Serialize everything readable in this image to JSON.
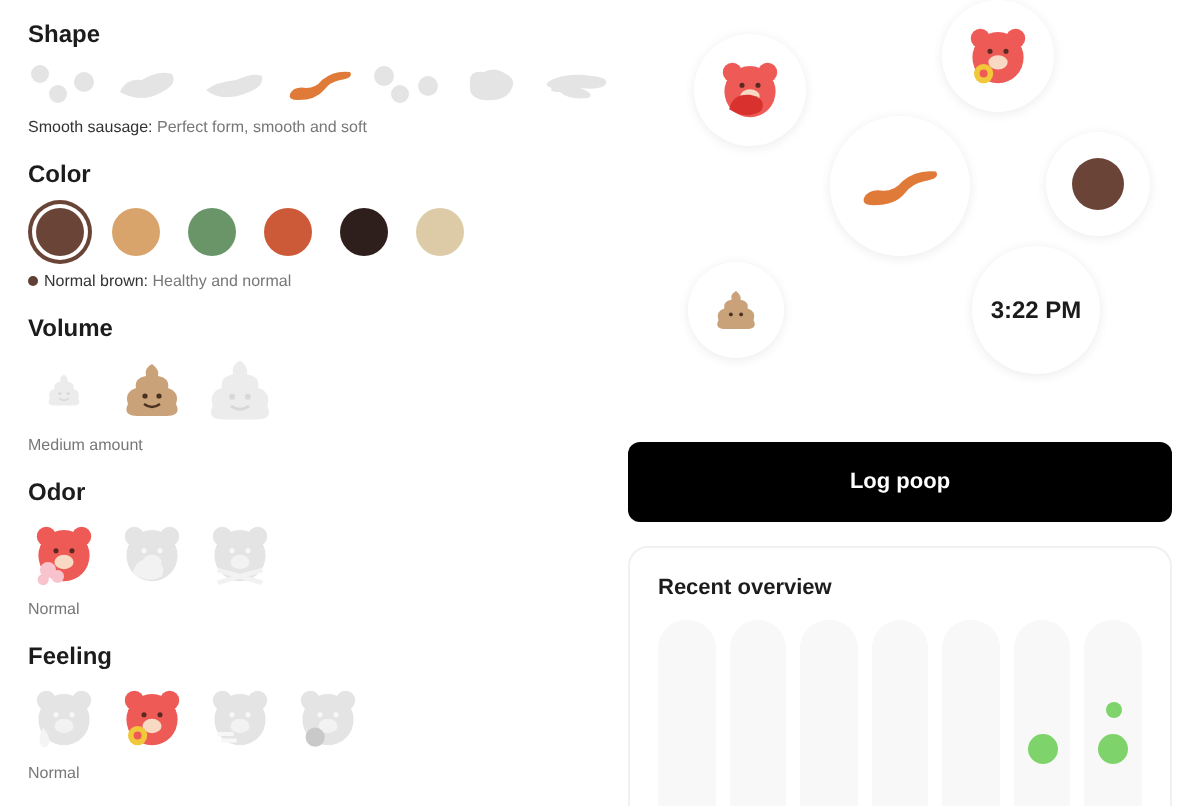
{
  "shape": {
    "title": "Shape",
    "options": [
      {
        "kind": "lumps",
        "selected": false
      },
      {
        "kind": "lumpy-sausage",
        "selected": false
      },
      {
        "kind": "cracked-sausage",
        "selected": false
      },
      {
        "kind": "smooth-sausage",
        "selected": true
      },
      {
        "kind": "soft-blobs",
        "selected": false
      },
      {
        "kind": "mushy",
        "selected": false
      },
      {
        "kind": "liquid",
        "selected": false
      }
    ],
    "caption": {
      "name": "Smooth sausage:",
      "description": "Perfect form, smooth and soft"
    }
  },
  "color": {
    "title": "Color",
    "options": [
      {
        "color": "#6b4438",
        "selected": true
      },
      {
        "color": "#d9a46c",
        "selected": false
      },
      {
        "color": "#6a9569",
        "selected": false
      },
      {
        "color": "#cc5a38",
        "selected": false
      },
      {
        "color": "#2e1f1c",
        "selected": false
      },
      {
        "color": "#dccba6",
        "selected": false
      }
    ],
    "caption": {
      "color": "#5e4037",
      "name": "Normal brown:",
      "description": "Healthy and normal"
    }
  },
  "volume": {
    "title": "Volume",
    "options": [
      {
        "kind": "small",
        "selected": false
      },
      {
        "kind": "medium",
        "selected": true
      },
      {
        "kind": "large",
        "selected": false
      }
    ],
    "caption": "Medium amount"
  },
  "odor": {
    "title": "Odor",
    "options": [
      {
        "kind": "flower",
        "selected": true
      },
      {
        "kind": "hand",
        "selected": false
      },
      {
        "kind": "crossbones",
        "selected": false
      }
    ],
    "caption": "Normal"
  },
  "feeling": {
    "title": "Feeling",
    "options": [
      {
        "kind": "drop",
        "selected": false
      },
      {
        "kind": "ok",
        "selected": true
      },
      {
        "kind": "wind",
        "selected": false
      },
      {
        "kind": "stone",
        "selected": false
      }
    ],
    "caption": "Normal"
  },
  "summary": [
    {
      "kind": "bear-hand"
    },
    {
      "kind": "bear-ok"
    },
    {
      "kind": "sausage"
    },
    {
      "kind": "color",
      "color": "#6b4438"
    },
    {
      "kind": "poop"
    },
    {
      "kind": "time",
      "text": "3:22 PM"
    }
  ],
  "log_button": "Log poop",
  "overview": {
    "title": "Recent overview",
    "columns": [
      {},
      {},
      {},
      {},
      {},
      {
        "dots": [
          {
            "kind": "large"
          }
        ]
      },
      {
        "dots": [
          {
            "kind": "small"
          },
          {
            "kind": "large"
          }
        ]
      }
    ]
  }
}
